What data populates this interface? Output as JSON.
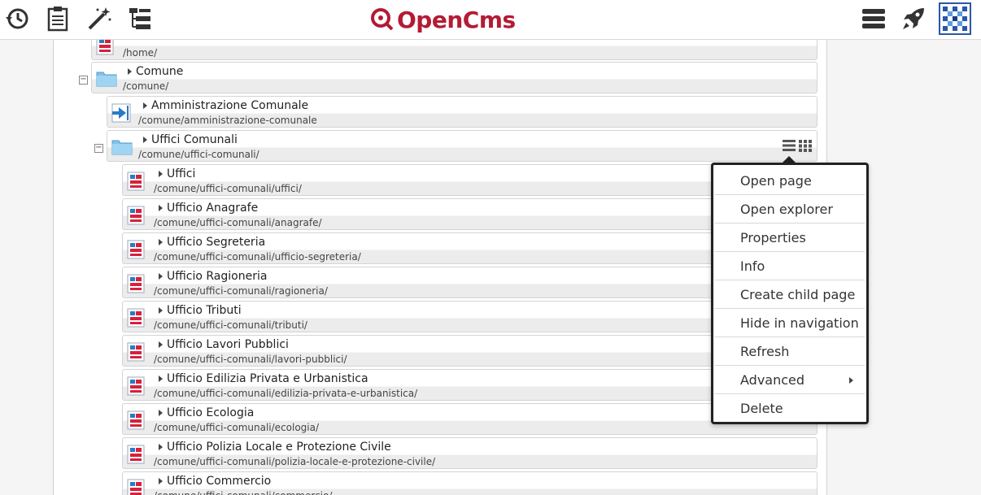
{
  "toolbar": {
    "left_icons": [
      "history-icon",
      "clipboard-icon",
      "magic-wand-icon",
      "sitemap-icon"
    ],
    "logo": {
      "text_main": "OpenCms",
      "brand_color": "#b31b34"
    },
    "right_icons": [
      "menu-icon",
      "publish-rocket-icon",
      "user-avatar-icon"
    ]
  },
  "tree": [
    {
      "title": "",
      "path": "/home/",
      "type": "page"
    },
    {
      "title": "Comune",
      "path": "/comune/",
      "type": "folder",
      "toggle": "−"
    },
    {
      "title": "Amministrazione Comunale",
      "path": "/comune/amministrazione-comunale",
      "type": "redirect"
    },
    {
      "title": "Uffici Comunali",
      "path": "/comune/uffici-comunali/",
      "type": "folder",
      "toggle": "−"
    },
    {
      "title": "Uffici",
      "path": "/comune/uffici-comunali/uffici/",
      "type": "page"
    },
    {
      "title": "Ufficio Anagrafe",
      "path": "/comune/uffici-comunali/anagrafe/",
      "type": "page"
    },
    {
      "title": "Ufficio Segreteria",
      "path": "/comune/uffici-comunali/ufficio-segreteria/",
      "type": "page"
    },
    {
      "title": "Ufficio Ragioneria",
      "path": "/comune/uffici-comunali/ragioneria/",
      "type": "page"
    },
    {
      "title": "Ufficio Tributi",
      "path": "/comune/uffici-comunali/tributi/",
      "type": "page"
    },
    {
      "title": "Ufficio Lavori Pubblici",
      "path": "/comune/uffici-comunali/lavori-pubblici/",
      "type": "page"
    },
    {
      "title": "Ufficio Edilizia Privata e Urbanistica",
      "path": "/comune/uffici-comunali/edilizia-privata-e-urbanistica/",
      "type": "page"
    },
    {
      "title": "Ufficio Ecologia",
      "path": "/comune/uffici-comunali/ecologia/",
      "type": "page"
    },
    {
      "title": "Ufficio Polizia Locale e Protezione Civile",
      "path": "/comune/uffici-comunali/polizia-locale-e-protezione-civile/",
      "type": "page"
    },
    {
      "title": "Ufficio Commercio",
      "path": "/comune/uffici-comunali/commercio/",
      "type": "page"
    }
  ],
  "context_menu": {
    "items": [
      {
        "label": "Open page"
      },
      {
        "label": "Open explorer"
      },
      {
        "label": "Properties"
      },
      {
        "label": "Info"
      },
      {
        "label": "Create child page"
      },
      {
        "label": "Hide in navigation"
      },
      {
        "label": "Refresh"
      },
      {
        "label": "Advanced",
        "submenu": true
      },
      {
        "label": "Delete"
      }
    ]
  },
  "colors": {
    "folder": "#7ec3ea",
    "page_red": "#d6213d",
    "page_blue": "#2a7bc4",
    "menu_border": "#222222"
  }
}
